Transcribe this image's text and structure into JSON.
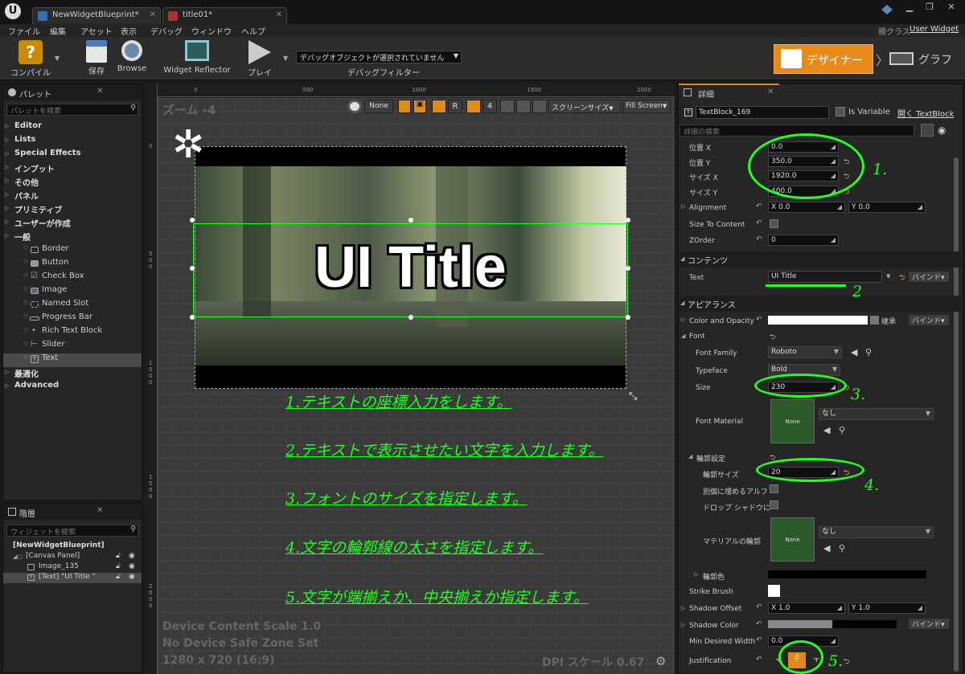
{
  "tabs": [
    {
      "label": "NewWidgetBlueprint*"
    },
    {
      "label": "title01*"
    }
  ],
  "parent_class": {
    "label": "親クラス",
    "value": "User Widget"
  },
  "menu": [
    "ファイル",
    "編集",
    "アセット",
    "表示",
    "デバッグ",
    "ウィンドウ",
    "ヘルプ"
  ],
  "toolbar": {
    "compile": "コンパイル",
    "save": "保存",
    "browse": "Browse",
    "widget_reflector": "Widget Reflector",
    "play": "プレイ",
    "debug_object": "デバッグオブジェクトが選択されていません",
    "debug_filter": "デバッグフィルター",
    "designer": "デザイナー",
    "graph": "グラフ"
  },
  "palette": {
    "title": "パレット",
    "search_placeholder": "パレットを検索",
    "categories": [
      "Editor",
      "Lists",
      "Special Effects",
      "インプット",
      "その他",
      "パネル",
      "プリミティブ",
      "ユーザーが作成"
    ],
    "general": "一般",
    "items": [
      "Border",
      "Button",
      "Check Box",
      "Image",
      "Named Slot",
      "Progress Bar",
      "Rich Text Block",
      "Slider",
      "Text"
    ],
    "after": [
      "最適化",
      "Advanced"
    ]
  },
  "hierarchy": {
    "title": "階層",
    "search_placeholder": "ウィジェットを検索",
    "items": [
      "[NewWidgetBlueprint]",
      "[Canvas Panel]",
      "Image_135",
      "[Text] \"UI Title \""
    ]
  },
  "viewport": {
    "zoom": "ズーム -4",
    "none": "None",
    "grid_num": "4",
    "screen_size": "スクリーンサイズ",
    "fill": "Fill Screen",
    "ruler_top": [
      "0",
      "500",
      "1000",
      "1500",
      "2000"
    ],
    "ruler_left": [
      "0",
      "500",
      "1000",
      "1500",
      "2000"
    ],
    "title_text": "UI Title",
    "device_scale": "Device Content Scale 1.0",
    "safe_zone": "No Device Safe Zone Set",
    "resolution": "1280 x 720 (16:9)",
    "dpi": "DPI スケール 0.67"
  },
  "annotations": [
    "1.テキストの座標入力をします。",
    "2.テキストで表示させたい文字を入力します。",
    "3.フォントのサイズを指定します。",
    "4.文字の輪郭線の太さを指定します。",
    "5.文字が端揃えか、中央揃えか指定します。"
  ],
  "details": {
    "title": "詳細",
    "name": "TextBlock_169",
    "is_variable": "Is Variable",
    "open": "開く TextBlock",
    "search_placeholder": "詳細の検索",
    "pos_x": {
      "label": "位置 X",
      "value": "0.0"
    },
    "pos_y": {
      "label": "位置 Y",
      "value": "350.0"
    },
    "size_x": {
      "label": "サイズ X",
      "value": "1920.0"
    },
    "size_y": {
      "label": "サイズ Y",
      "value": "400.0"
    },
    "alignment": {
      "label": "Alignment",
      "x": "X  0.0",
      "y": "Y  0.0"
    },
    "size_to_content": "Size To Content",
    "zorder": {
      "label": "ZOrder",
      "value": "0"
    },
    "contents": "コンテンツ",
    "text": {
      "label": "Text",
      "value": "UI Title"
    },
    "bind": "バインド",
    "appearance": "アピアランス",
    "color_opacity": "Color and Opacity",
    "inherit": "継承",
    "font": "Font",
    "font_family": {
      "label": "Font Family",
      "value": "Roboto"
    },
    "typeface": {
      "label": "Typeface",
      "value": "Bold"
    },
    "size": {
      "label": "Size",
      "value": "230"
    },
    "font_material": {
      "label": "Font Material",
      "value": "なし"
    },
    "none_thumb": "None",
    "outline": "輪郭設定",
    "outline_size": {
      "label": "輪郭サイズ",
      "value": "20"
    },
    "separate_fill": "別個に埋めるアルフ",
    "drop_shadow": "ドロップ シャドウに",
    "outline_material": {
      "label": "マテリアルの輪郭",
      "value": "なし"
    },
    "outline_color": "輪郭色",
    "strike_brush": "Strike Brush",
    "shadow_offset": {
      "label": "Shadow Offset",
      "x": "X  1.0",
      "y": "Y  1.0"
    },
    "shadow_color": "Shadow Color",
    "min_width": {
      "label": "Min Desired Width",
      "value": "0.0"
    },
    "justification": "Justification"
  },
  "callouts": [
    "1.",
    "2",
    "3.",
    "4.",
    "5."
  ]
}
